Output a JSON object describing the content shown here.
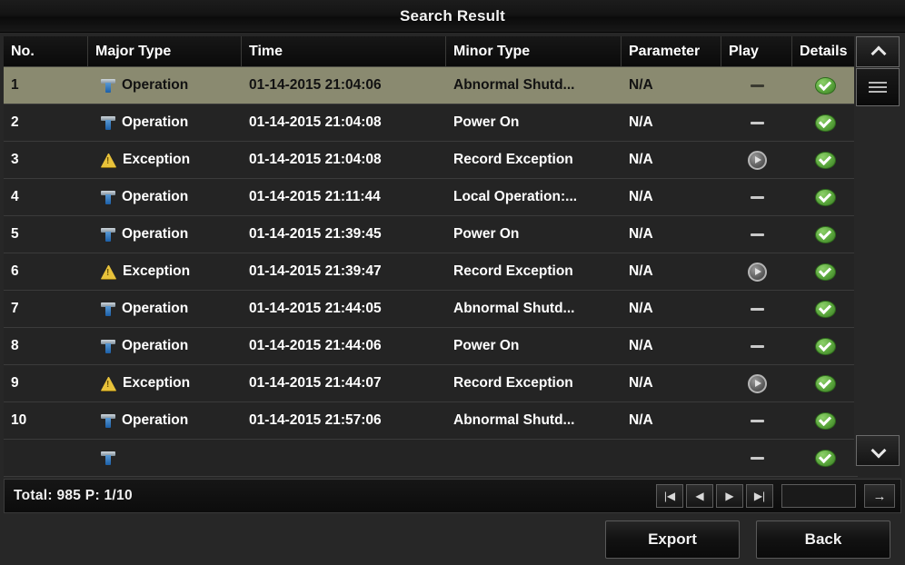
{
  "window": {
    "title": "Search Result"
  },
  "table": {
    "columns": [
      {
        "key": "no",
        "label": "No."
      },
      {
        "key": "major",
        "label": "Major Type"
      },
      {
        "key": "time",
        "label": "Time"
      },
      {
        "key": "minor",
        "label": "Minor Type"
      },
      {
        "key": "param",
        "label": "Parameter"
      },
      {
        "key": "play",
        "label": "Play"
      },
      {
        "key": "details",
        "label": "Details"
      }
    ],
    "rows": [
      {
        "no": "1",
        "icon": "tool-icon",
        "major": "Operation",
        "time": "01-14-2015 21:04:06",
        "minor": "Abnormal Shutd...",
        "param": "N/A",
        "play": "dash-icon",
        "details": "green-check-icon",
        "selected": true
      },
      {
        "no": "2",
        "icon": "tool-icon",
        "major": "Operation",
        "time": "01-14-2015 21:04:08",
        "minor": "Power On",
        "param": "N/A",
        "play": "dash-icon",
        "details": "green-check-icon",
        "selected": false
      },
      {
        "no": "3",
        "icon": "warning-icon",
        "major": "Exception",
        "time": "01-14-2015 21:04:08",
        "minor": "Record Exception",
        "param": "N/A",
        "play": "play-circle-icon",
        "details": "green-check-icon",
        "selected": false
      },
      {
        "no": "4",
        "icon": "tool-icon",
        "major": "Operation",
        "time": "01-14-2015 21:11:44",
        "minor": "Local Operation:...",
        "param": "N/A",
        "play": "dash-icon",
        "details": "green-check-icon",
        "selected": false
      },
      {
        "no": "5",
        "icon": "tool-icon",
        "major": "Operation",
        "time": "01-14-2015 21:39:45",
        "minor": "Power On",
        "param": "N/A",
        "play": "dash-icon",
        "details": "green-check-icon",
        "selected": false
      },
      {
        "no": "6",
        "icon": "warning-icon",
        "major": "Exception",
        "time": "01-14-2015 21:39:47",
        "minor": "Record Exception",
        "param": "N/A",
        "play": "play-circle-icon",
        "details": "green-check-icon",
        "selected": false
      },
      {
        "no": "7",
        "icon": "tool-icon",
        "major": "Operation",
        "time": "01-14-2015 21:44:05",
        "minor": "Abnormal Shutd...",
        "param": "N/A",
        "play": "dash-icon",
        "details": "green-check-icon",
        "selected": false
      },
      {
        "no": "8",
        "icon": "tool-icon",
        "major": "Operation",
        "time": "01-14-2015 21:44:06",
        "minor": "Power On",
        "param": "N/A",
        "play": "dash-icon",
        "details": "green-check-icon",
        "selected": false
      },
      {
        "no": "9",
        "icon": "warning-icon",
        "major": "Exception",
        "time": "01-14-2015 21:44:07",
        "minor": "Record Exception",
        "param": "N/A",
        "play": "play-circle-icon",
        "details": "green-check-icon",
        "selected": false
      },
      {
        "no": "10",
        "icon": "tool-icon",
        "major": "Operation",
        "time": "01-14-2015 21:57:06",
        "minor": "Abnormal Shutd...",
        "param": "N/A",
        "play": "dash-icon",
        "details": "green-check-icon",
        "selected": false
      },
      {
        "no": "",
        "icon": "tool-icon",
        "major": "",
        "time": "",
        "minor": "",
        "param": "",
        "play": "dash-icon",
        "details": "green-check-icon",
        "selected": false
      }
    ]
  },
  "scrollbar": {
    "up_icon": "chevron-up-icon",
    "down_icon": "chevron-down-icon",
    "thumb_icon": "scroll-thumb-grip-icon"
  },
  "status": {
    "text": "Total: 985  P: 1/10"
  },
  "pager": {
    "first_label": "|◀",
    "prev_label": "◀",
    "next_label": "▶",
    "last_label": "▶|",
    "page_value": "",
    "page_placeholder": "",
    "go_label": "→"
  },
  "footer": {
    "export_label": "Export",
    "back_label": "Back"
  },
  "colors": {
    "selected_row": "#8a8a70",
    "row_background": "#242424",
    "header_background": "#0d0d0d",
    "panel_background": "#272727",
    "success_green": "#5aa63c",
    "warning_amber": "#e8c23a",
    "tool_blue": "#1b5fa8"
  }
}
